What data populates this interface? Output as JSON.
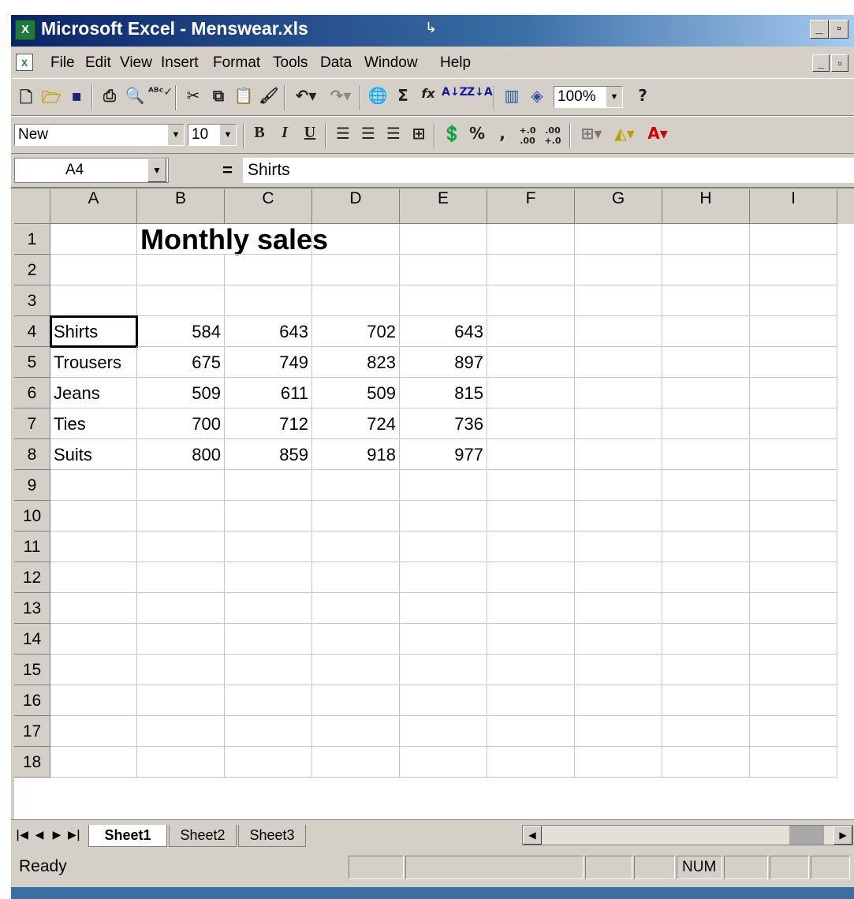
{
  "window": {
    "title": "Microsoft Excel - Menswear.xls",
    "app_icon": "excel-icon",
    "caption_buttons": [
      "minimize-icon",
      "restore-icon"
    ]
  },
  "menubar": {
    "items": [
      "File",
      "Edit",
      "View",
      "Insert",
      "Format",
      "Tools",
      "Data",
      "Window",
      "Help"
    ],
    "doc_controls": [
      "minimize-icon",
      "restore-icon"
    ]
  },
  "toolbar_standard": {
    "icons": [
      "new-icon",
      "open-icon",
      "save-icon",
      "print-icon",
      "print-preview-icon",
      "spelling-icon",
      "cut-icon",
      "copy-icon",
      "paste-icon",
      "format-painter-icon",
      "undo-icon",
      "redo-icon",
      "hyperlink-icon",
      "autosum-icon",
      "function-icon",
      "sort-ascending-icon",
      "sort-descending-icon",
      "chart-wizard-icon",
      "drawing-icon",
      "help-icon"
    ],
    "zoom": "100%"
  },
  "toolbar_formatting": {
    "style": "New",
    "font_size": "10",
    "bold": "B",
    "italic": "I",
    "underline": "U",
    "percent": "%",
    "comma": ",",
    "inc_decimal": "+.0 .00",
    "dec_decimal": ".00 +.0"
  },
  "formula_bar": {
    "name_box": "A4",
    "equals": "=",
    "content": "Shirts"
  },
  "sheet": {
    "columns": [
      "A",
      "B",
      "C",
      "D",
      "E",
      "F",
      "G",
      "H",
      "I"
    ],
    "rows": [
      "1",
      "2",
      "3",
      "4",
      "5",
      "6",
      "7",
      "8",
      "9",
      "10",
      "11",
      "12",
      "13",
      "14",
      "15",
      "16",
      "17",
      "18"
    ],
    "title": "Monthly sales",
    "data": [
      {
        "label": "Shirts",
        "values": [
          "584",
          "643",
          "702",
          "643"
        ]
      },
      {
        "label": "Trousers",
        "values": [
          "675",
          "749",
          "823",
          "897"
        ]
      },
      {
        "label": "Jeans",
        "values": [
          "509",
          "611",
          "509",
          "815"
        ]
      },
      {
        "label": "Ties",
        "values": [
          "700",
          "712",
          "724",
          "736"
        ]
      },
      {
        "label": "Suits",
        "values": [
          "800",
          "859",
          "918",
          "977"
        ]
      }
    ],
    "selected_cell": "A4"
  },
  "sheet_tabs": [
    "Sheet1",
    "Sheet2",
    "Sheet3"
  ],
  "status": {
    "text": "Ready",
    "num": "NUM"
  }
}
